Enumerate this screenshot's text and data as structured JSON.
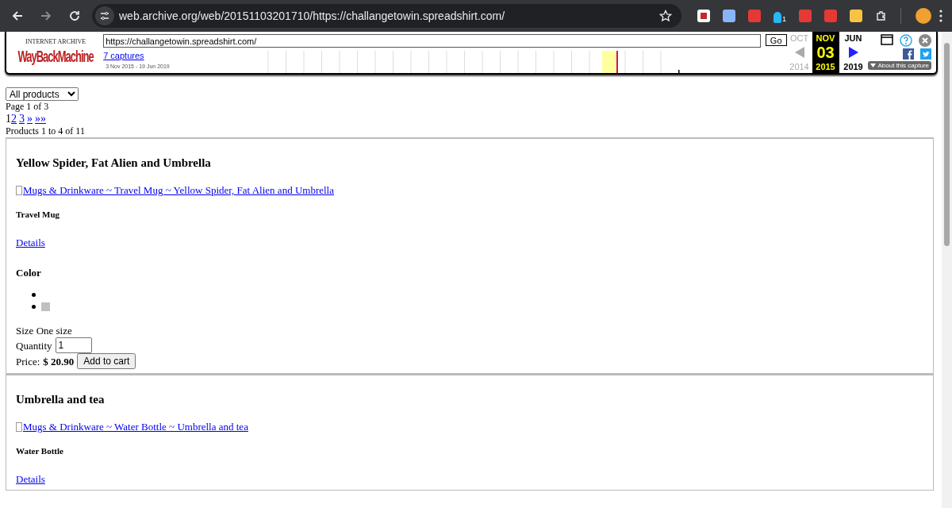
{
  "browser": {
    "url": "web.archive.org/web/20151103201710/https://challangetowin.spreadshirt.com/",
    "extension_badge": "1"
  },
  "wayback": {
    "logo_top": "INTERNET ARCHIVE",
    "logo": "WayBackMachine",
    "url_value": "https://challangetowin.spreadshirt.com/",
    "go": "Go",
    "captures": "7 captures",
    "range": "3 Nov 2015 - 19 Jun 2019",
    "prev_month": "OCT",
    "cur_month": "NOV",
    "next_month": "JUN",
    "day": "03",
    "prev_year": "2014",
    "cur_year": "2015",
    "next_year": "2019",
    "about": "About this capture"
  },
  "filter": {
    "value": "All products"
  },
  "page_info": "Page 1 of 3",
  "pages": [
    {
      "label": "1",
      "selected": true
    },
    {
      "label": "2",
      "selected": false
    },
    {
      "label": "3",
      "selected": false
    },
    {
      "label": "»",
      "selected": false
    },
    {
      "label": "»»",
      "selected": false
    }
  ],
  "products_info": "Products 1 to 4 of 11",
  "products": [
    {
      "title": "Yellow Spider, Fat Alien and Umbrella",
      "image_link": "Mugs & Drinkware ~ Travel Mug ~ Yellow Spider, Fat Alien and Umbrella",
      "type": "Travel Mug",
      "details": "Details",
      "color_heading": "Color",
      "swatches": [
        {
          "kind": "empty"
        },
        {
          "kind": "swatch",
          "color": "#c0c0c0"
        }
      ],
      "size": "Size One size",
      "quantity_label": "Quantity",
      "quantity": "1",
      "price_label": "Price:",
      "price": "$ 20.90",
      "cart": "Add to cart"
    },
    {
      "title": "Umbrella and tea",
      "image_link": "Mugs & Drinkware ~ Water Bottle ~ Umbrella and tea",
      "type": "Water Bottle",
      "details": "Details"
    }
  ]
}
